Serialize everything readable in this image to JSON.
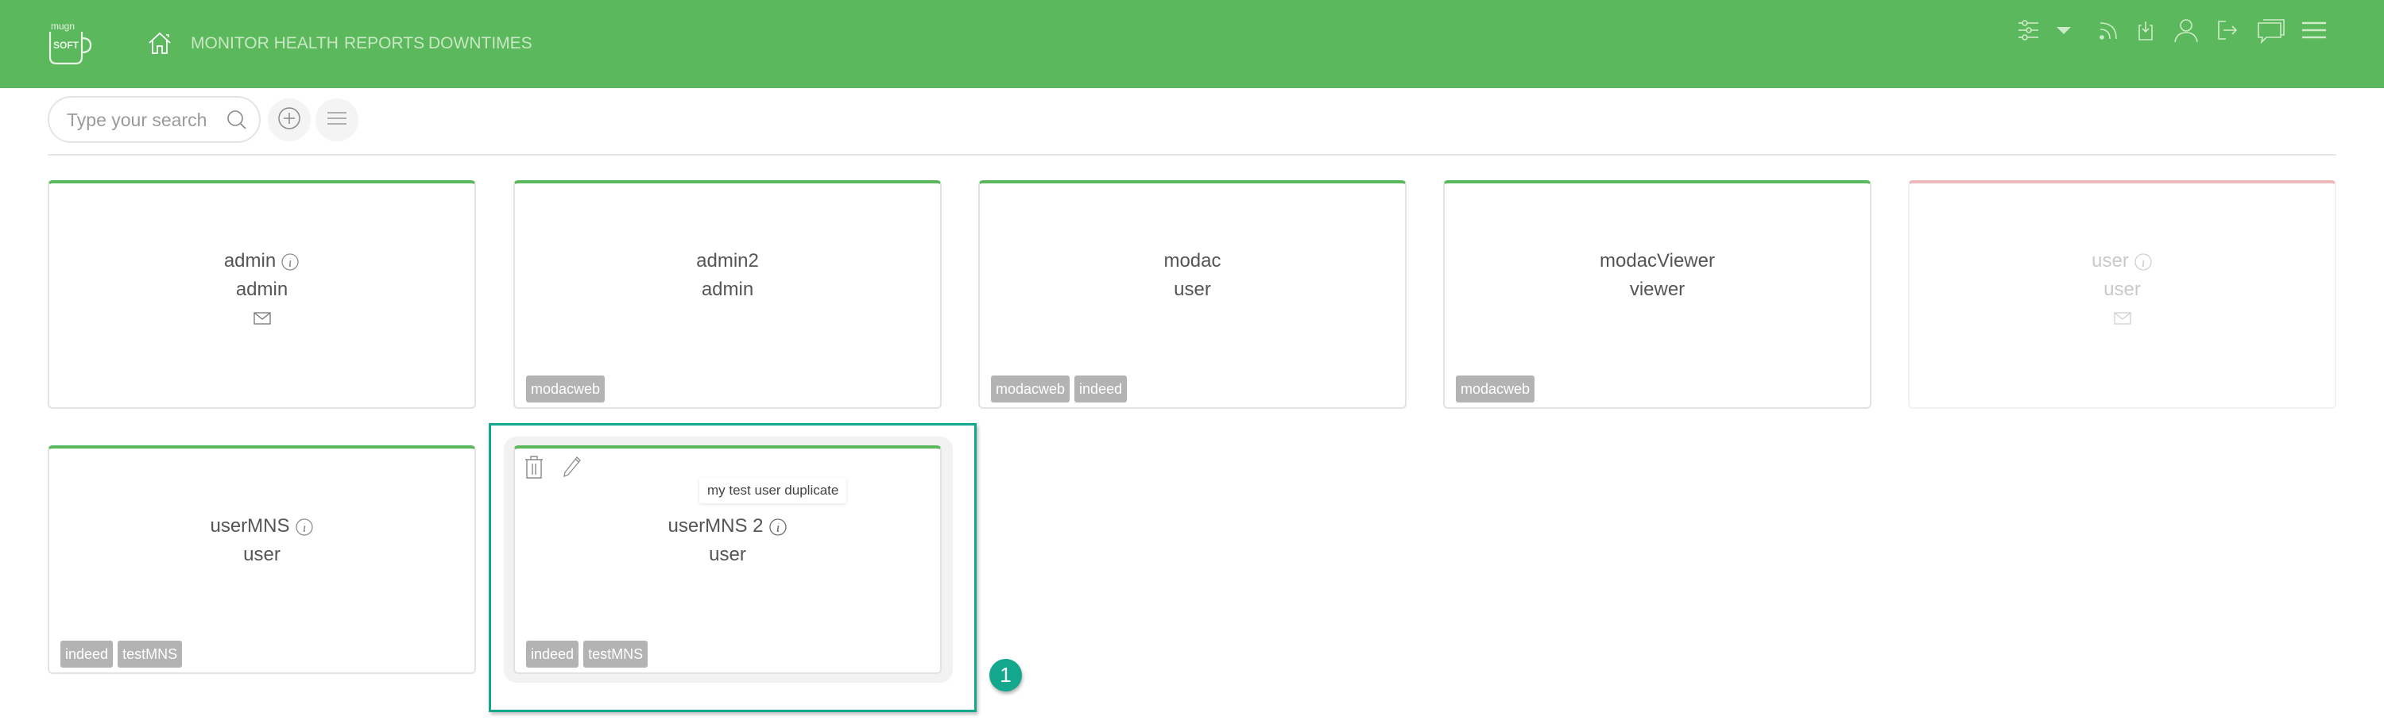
{
  "header": {
    "logo": {
      "top_text": "mugn",
      "inner_text": "SOFT"
    },
    "nav": [
      {
        "icon": "home-icon"
      },
      {
        "label": "MONITOR HEALTH"
      },
      {
        "label": "REPORTS"
      },
      {
        "label": "DOWNTIMES"
      }
    ],
    "right_icons": [
      "sliders-icon",
      "caret-down-icon",
      "rss-icon",
      "import-icon",
      "user-icon",
      "logout-icon",
      "chat-icon",
      "hamburger-icon"
    ],
    "colors": {
      "bar": "#5cb85c",
      "nav_text": "#c7e8c2"
    }
  },
  "toolbar": {
    "search": {
      "placeholder": "Type your search",
      "value": ""
    },
    "add_button": "plus-circle-icon",
    "list_button": "list-icon"
  },
  "cards": [
    {
      "name": "admin",
      "role": "admin",
      "info": true,
      "mail": true,
      "tags": [],
      "status": "active"
    },
    {
      "name": "admin2",
      "role": "admin",
      "info": false,
      "mail": false,
      "tags": [
        "modacweb"
      ],
      "status": "active"
    },
    {
      "name": "modac",
      "role": "user",
      "info": false,
      "mail": false,
      "tags": [
        "modacweb",
        "indeed"
      ],
      "status": "active"
    },
    {
      "name": "modacViewer",
      "role": "viewer",
      "info": false,
      "mail": false,
      "tags": [
        "modacweb"
      ],
      "status": "active"
    },
    {
      "name": "user",
      "role": "user",
      "info": true,
      "mail": true,
      "tags": [],
      "status": "disabled"
    },
    {
      "name": "userMNS",
      "role": "user",
      "info": true,
      "mail": false,
      "tags": [
        "indeed",
        "testMNS"
      ],
      "status": "active"
    },
    {
      "name": "userMNS 2",
      "role": "user",
      "info": true,
      "mail": false,
      "tags": [
        "indeed",
        "testMNS"
      ],
      "status": "active",
      "hovered": true,
      "tooltip": "my test user duplicate"
    }
  ],
  "annotation": {
    "label": "1",
    "color": "#13a88d"
  },
  "colors": {
    "active": "#5cb85c",
    "disabled": "#efb9b9",
    "tag_bg": "#b3b3b3"
  }
}
